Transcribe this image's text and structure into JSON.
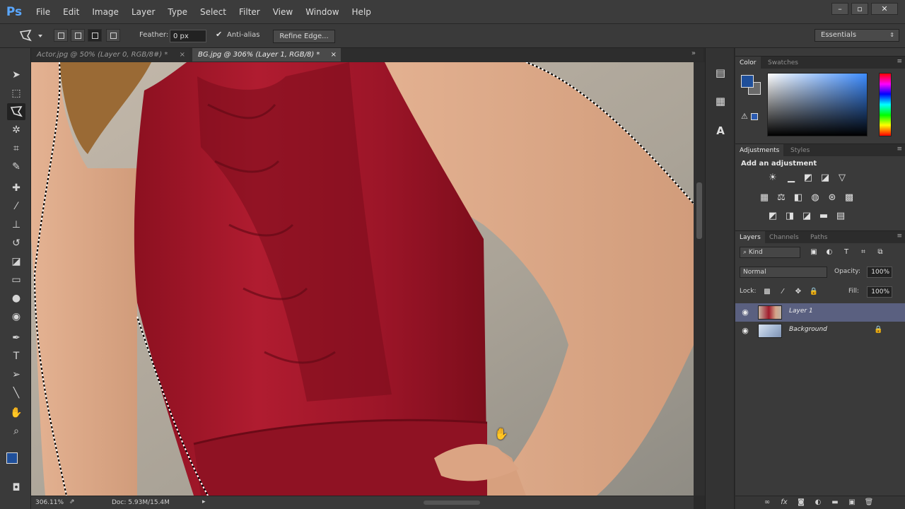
{
  "app": {
    "logo": "Ps",
    "menu": [
      "File",
      "Edit",
      "Image",
      "Layer",
      "Type",
      "Select",
      "Filter",
      "View",
      "Window",
      "Help"
    ],
    "window_controls": {
      "minimize": "–",
      "restore": "▫",
      "close": "✕"
    }
  },
  "options_bar": {
    "feather_label": "Feather:",
    "feather_value": "0 px",
    "antialias_label": "Anti-alias",
    "antialias_checked": true,
    "refine_edge_label": "Refine Edge...",
    "workspace": "Essentials"
  },
  "document_tabs": [
    {
      "label": "Actor.jpg @ 50% (Layer 0, RGB/8#) *",
      "active": false
    },
    {
      "label": "BG.jpg @ 306% (Layer 1, RGB/8) *",
      "active": true
    }
  ],
  "status_bar": {
    "zoom": "306.11%",
    "doc_info": "Doc: 5.93M/15.4M"
  },
  "panels": {
    "color": {
      "tabs": [
        "Color",
        "Swatches"
      ],
      "foreground": "#1f4f9a",
      "background": "#6a6a6a"
    },
    "adjustments": {
      "tabs": [
        "Adjustments",
        "Styles"
      ],
      "heading": "Add an adjustment"
    },
    "layers": {
      "tabs": [
        "Layers",
        "Channels",
        "Paths"
      ],
      "filter_kind": "Kind",
      "blend_mode": "Normal",
      "opacity_label": "Opacity:",
      "opacity_value": "100%",
      "lock_label": "Lock:",
      "fill_label": "Fill:",
      "fill_value": "100%",
      "items": [
        {
          "name": "Layer 1",
          "selected": true,
          "visible": true,
          "locked": false
        },
        {
          "name": "Background",
          "selected": false,
          "visible": true,
          "locked": true
        }
      ]
    }
  },
  "colors": {
    "chrome": "#3a3a3a",
    "dark": "#2b2b2b",
    "selection_blue": "#5a6080",
    "dress_red": "#9e1426"
  }
}
